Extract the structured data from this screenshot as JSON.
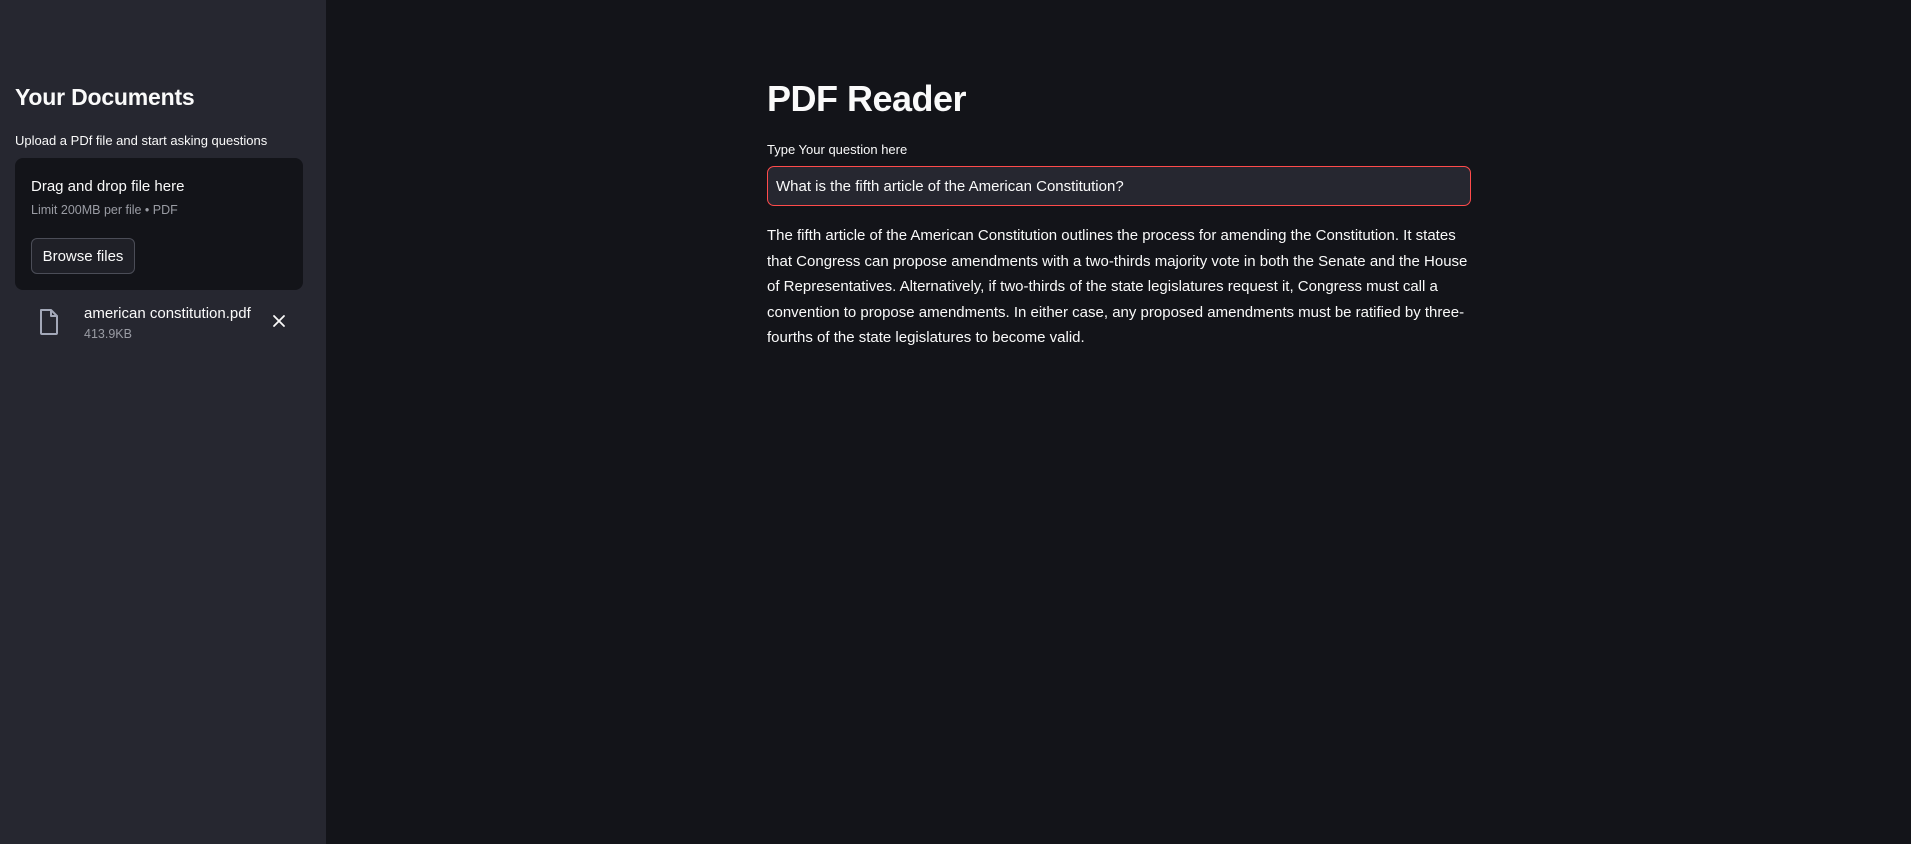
{
  "sidebar": {
    "title": "Your Documents",
    "caption": "Upload a PDf file and start asking questions",
    "uploader": {
      "dropzone_title": "Drag and drop file here",
      "dropzone_subtitle": "Limit 200MB per file • PDF",
      "browse_label": "Browse files"
    },
    "file": {
      "name": "american constitution.pdf",
      "size": "413.9KB",
      "icon": "file-icon",
      "remove_icon": "close-icon"
    }
  },
  "main": {
    "title": "PDF Reader",
    "question_label": "Type Your question here",
    "question_value": "What is the fifth article of the American Constitution?",
    "answer": "The fifth article of the American Constitution outlines the process for amending the Constitution. It states that Congress can propose amendments with a two-thirds majority vote in both the Senate and the House of Representatives. Alternatively, if two-thirds of the state legislatures request it, Congress must call a convention to propose amendments. In either case, any proposed amendments must be ratified by three-fourths of the state legislatures to become valid."
  },
  "colors": {
    "sidebar_bg": "#262730",
    "main_bg": "#131419",
    "input_focus_border": "#ff4b4b",
    "text": "#fafafa",
    "muted_text": "#9a9ca4"
  }
}
